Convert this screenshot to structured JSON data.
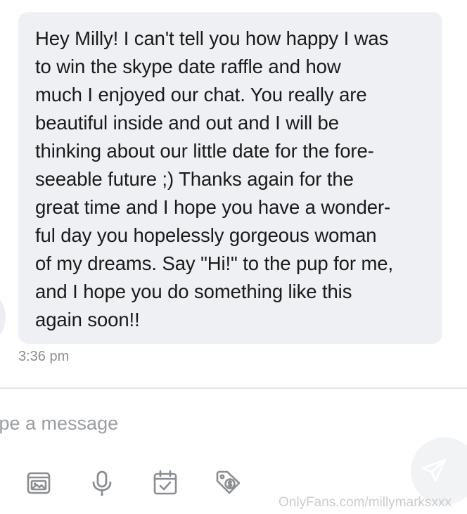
{
  "message": {
    "text": "Hey Milly! I can't tell you how happy I was\nto win the skype date raffle and how\nmuch I enjoyed our chat. You really are\nbeautiful inside and out and I will be\nthinking about our little date for the fore-\nseeable future ;) Thanks again for the\ngreat time and I hope you have a wonder-\nful day you hopelessly gorgeous woman\nof my dreams. Say \"Hi!\" to the pup for me,\nand I hope you do something like this\nagain soon!!",
    "time": "3:36 pm"
  },
  "composer": {
    "placeholder": "Type a message",
    "value": "",
    "tools": [
      {
        "icon": "image-icon"
      },
      {
        "icon": "microphone-icon"
      },
      {
        "icon": "calendar-check-icon"
      },
      {
        "icon": "price-tag-icon"
      }
    ],
    "send_icon": "send-icon"
  },
  "watermark": "OnlyFans.com/millymarksxxx",
  "colors": {
    "bubble": "#eef0f3",
    "icon": "#8a8d91",
    "placeholder": "#9a9da1",
    "timestamp": "#8a8d91",
    "divider": "#e6e7e9"
  }
}
